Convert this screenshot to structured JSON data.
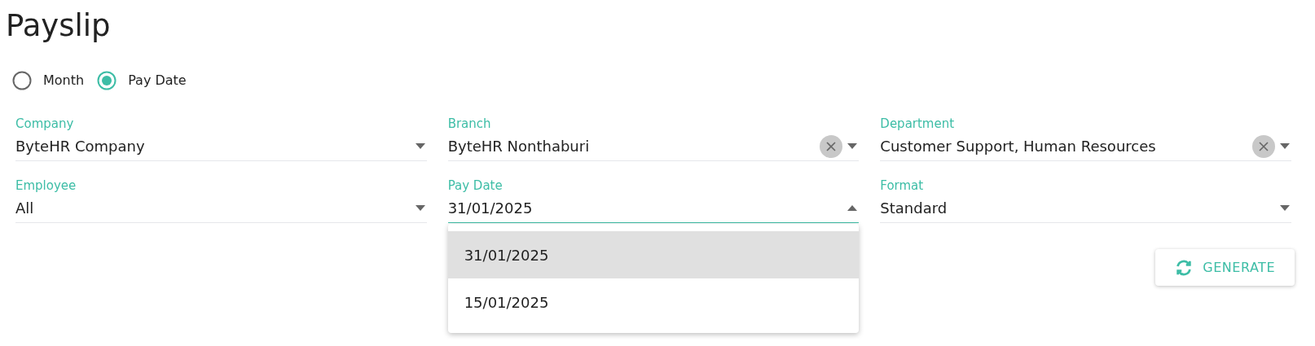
{
  "title": "Payslip",
  "radios": [
    {
      "label": "Month",
      "selected": false
    },
    {
      "label": "Pay Date",
      "selected": true
    }
  ],
  "fields": [
    {
      "label": "Company",
      "value": "ByteHR Company",
      "clearable": false,
      "open": false
    },
    {
      "label": "Branch",
      "value": "ByteHR Nonthaburi",
      "clearable": true,
      "open": false
    },
    {
      "label": "Department",
      "value": "Customer Support, Human Resources",
      "clearable": true,
      "open": false
    },
    {
      "label": "Employee",
      "value": "All",
      "clearable": false,
      "open": false
    },
    {
      "label": "Pay Date",
      "value": "31/01/2025",
      "clearable": false,
      "open": true,
      "options": [
        {
          "label": "31/01/2025",
          "selected": true
        },
        {
          "label": "15/01/2025",
          "selected": false
        }
      ]
    },
    {
      "label": "Format",
      "value": "Standard",
      "clearable": false,
      "open": false
    }
  ],
  "generate_button": {
    "label": "GENERATE"
  }
}
